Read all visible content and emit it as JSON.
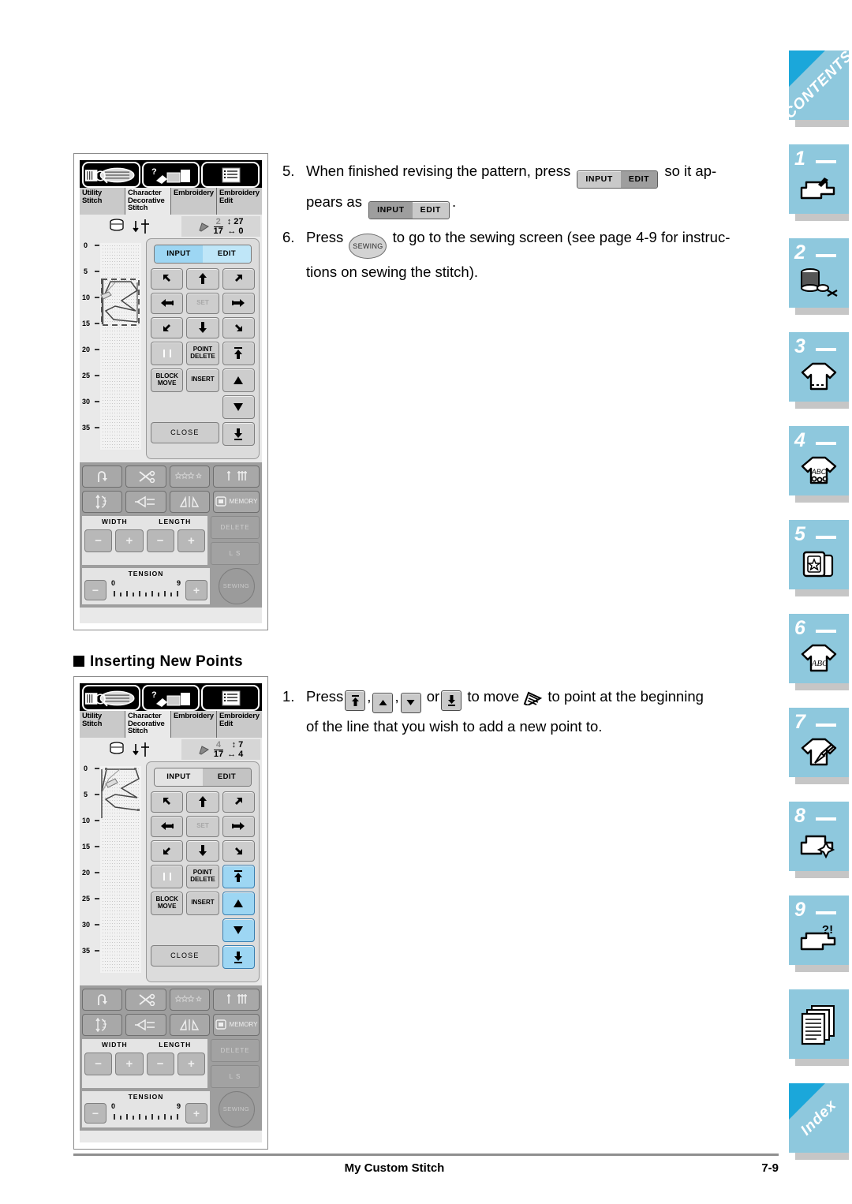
{
  "document": {
    "footer_title": "My Custom Stitch",
    "page_number": "7-9",
    "section_heading": "Inserting New Points"
  },
  "sidebar": {
    "tabs": [
      {
        "name": "contents",
        "label": "CONTENTS",
        "number": "",
        "icon": "contents-corner"
      },
      {
        "name": "chapter-1",
        "label": "",
        "number": "1",
        "icon": "sewing-machine-hand-icon"
      },
      {
        "name": "chapter-2",
        "label": "",
        "number": "2",
        "icon": "spool-bobbin-scissors-icon"
      },
      {
        "name": "chapter-3",
        "label": "",
        "number": "3",
        "icon": "tshirt-stitch-icon"
      },
      {
        "name": "chapter-4",
        "label": "",
        "number": "4",
        "icon": "tshirt-abc-icon"
      },
      {
        "name": "chapter-5",
        "label": "",
        "number": "5",
        "icon": "embroidery-card-star-icon"
      },
      {
        "name": "chapter-6",
        "label": "",
        "number": "6",
        "icon": "tshirt-letters-icon"
      },
      {
        "name": "chapter-7",
        "label": "",
        "number": "7",
        "icon": "tshirt-pen-icon"
      },
      {
        "name": "chapter-8",
        "label": "",
        "number": "8",
        "icon": "machine-sparkle-icon"
      },
      {
        "name": "chapter-9",
        "label": "",
        "number": "9",
        "icon": "machine-question-icon"
      },
      {
        "name": "appendix",
        "label": "",
        "number": "",
        "icon": "pages-stack-icon"
      },
      {
        "name": "index",
        "label": "Index",
        "number": "",
        "icon": "index-corner"
      }
    ]
  },
  "steps": [
    {
      "number": "5.",
      "text_a": "When finished revising the pattern, press",
      "button_a": {
        "input": "INPUT",
        "edit": "EDIT",
        "active": "edit"
      },
      "text_b": "so it ap-",
      "text_c": "pears as",
      "button_b": {
        "input": "INPUT",
        "edit": "EDIT",
        "active": "input"
      },
      "text_d": "."
    },
    {
      "number": "6.",
      "text_a": "Press",
      "button_sewing": "SEWING",
      "text_b": "to go to the sewing screen (see page 4-9 for instruc-",
      "text_c": "tions on sewing the stitch)."
    },
    {
      "number": "1.",
      "text_a": "Press",
      "keys": [
        "jump-to-start-icon",
        "up-triangle-icon",
        "down-triangle-icon",
        "jump-to-end-icon"
      ],
      "text_or": "or",
      "text_b": "to move",
      "cursor_icon": "pen-cursor-icon",
      "text_c": "to point at the beginning",
      "text_d": "of the line that you wish to add a new point to."
    }
  ],
  "lcd_screens": [
    {
      "id": "screen-top",
      "tabs": [
        {
          "label": "Utility\nStitch",
          "active": false
        },
        {
          "label": "Character\nDecorative\nStitch",
          "active": true
        },
        {
          "label": "Embroidery",
          "active": false
        },
        {
          "label": "Embroidery\nEdit",
          "active": false
        }
      ],
      "icons": [
        "stitch-selection-icon",
        "machine-help-icon",
        "settings-list-icon"
      ],
      "status": {
        "point_current": "2",
        "point_total": "17",
        "vertical_value": "27",
        "horizontal_value": "0"
      },
      "ruler_ticks": [
        "0",
        "5",
        "10",
        "15",
        "20",
        "25",
        "30",
        "35"
      ],
      "input_edit": {
        "input": "INPUT",
        "edit": "EDIT",
        "mode": "edit-highlighted"
      },
      "arrow_keys": [
        "arrow-up-left",
        "arrow-up",
        "arrow-up-right",
        "arrow-left",
        "SET",
        "arrow-right",
        "arrow-down-left",
        "arrow-down",
        "arrow-down-right"
      ],
      "set_label": "SET",
      "action_keys": {
        "double_bar": "",
        "point_delete": "POINT\nDELETE",
        "block_move": "BLOCK\nMOVE",
        "insert": "INSERT",
        "close": "CLOSE"
      },
      "nav_keys": [
        "jump-to-start",
        "step-up",
        "step-down",
        "jump-to-end"
      ],
      "nav_highlighted": false,
      "bottom_bar": {
        "row1": [
          "reverse-stitch-icon",
          "thread-cutter-icon",
          "auto-stitch-icon",
          "needle-mode-icon"
        ],
        "row2": [
          "needle-position-icon",
          "mirror-flip-icon",
          "pattern-elongation-icon",
          "MEMORY"
        ],
        "width_label": "WIDTH",
        "length_label": "LENGTH",
        "minus": "−",
        "plus": "+",
        "delete_label": "DELETE",
        "ls_label": "L    S",
        "tension_label": "TENSION",
        "tension_min": "0",
        "tension_max": "9",
        "sewing_label": "SEWING"
      }
    },
    {
      "id": "screen-bottom",
      "tabs": [
        {
          "label": "Utility\nStitch",
          "active": false
        },
        {
          "label": "Character\nDecorative\nStitch",
          "active": true
        },
        {
          "label": "Embroidery",
          "active": false
        },
        {
          "label": "Embroidery\nEdit",
          "active": false
        }
      ],
      "icons": [
        "stitch-selection-icon",
        "machine-help-icon",
        "settings-list-icon"
      ],
      "status": {
        "point_current": "4",
        "point_total": "17",
        "vertical_value": "7",
        "horizontal_value": "4"
      },
      "ruler_ticks": [
        "0",
        "5",
        "10",
        "15",
        "20",
        "25",
        "30",
        "35"
      ],
      "input_edit": {
        "input": "INPUT",
        "edit": "EDIT",
        "mode": "edit-gray"
      },
      "arrow_keys": [
        "arrow-up-left",
        "arrow-up",
        "arrow-up-right",
        "arrow-left",
        "SET",
        "arrow-right",
        "arrow-down-left",
        "arrow-down",
        "arrow-down-right"
      ],
      "set_label": "SET",
      "action_keys": {
        "double_bar": "",
        "point_delete": "POINT\nDELETE",
        "block_move": "BLOCK\nMOVE",
        "insert": "INSERT",
        "close": "CLOSE"
      },
      "nav_keys": [
        "jump-to-start",
        "step-up",
        "step-down",
        "jump-to-end"
      ],
      "nav_highlighted": true,
      "bottom_bar": {
        "row1": [
          "reverse-stitch-icon",
          "thread-cutter-icon",
          "auto-stitch-icon",
          "needle-mode-icon"
        ],
        "row2": [
          "needle-position-icon",
          "mirror-flip-icon",
          "pattern-elongation-icon",
          "MEMORY"
        ],
        "width_label": "WIDTH",
        "length_label": "LENGTH",
        "minus": "−",
        "plus": "+",
        "delete_label": "DELETE",
        "ls_label": "L    S",
        "tension_label": "TENSION",
        "tension_min": "0",
        "tension_max": "9",
        "sewing_label": "SEWING"
      }
    }
  ]
}
